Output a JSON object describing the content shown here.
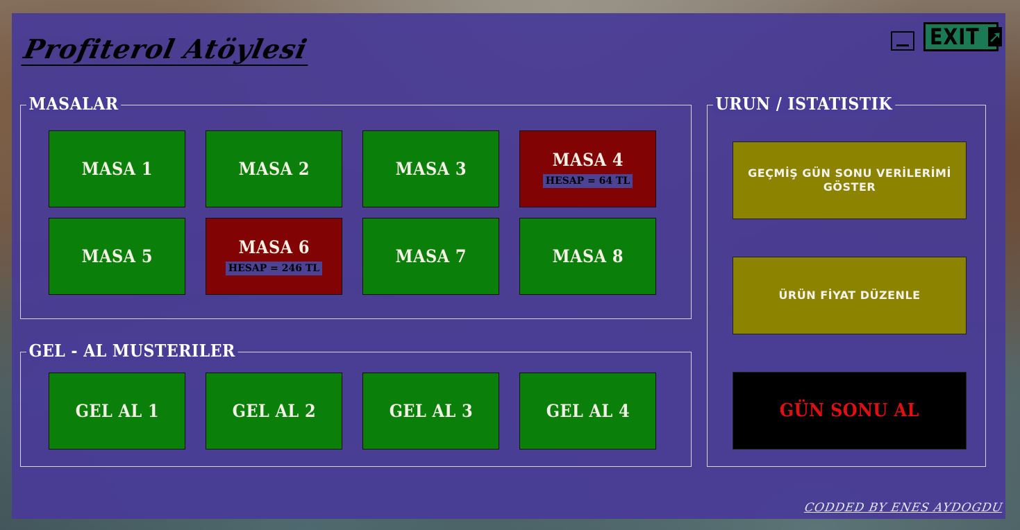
{
  "app": {
    "title": "Profiterol Atöylesi"
  },
  "window_controls": {
    "minimize_icon": "minimize-icon",
    "exit_label": "EXIT",
    "exit_icon": "arrow-up-right-icon",
    "exit_arrow_glyph": "➚"
  },
  "masalar": {
    "title": "MASALAR",
    "tables": [
      {
        "label": "MASA 1",
        "status": "free",
        "bill": ""
      },
      {
        "label": "MASA 2",
        "status": "free",
        "bill": ""
      },
      {
        "label": "MASA 3",
        "status": "free",
        "bill": ""
      },
      {
        "label": "MASA 4",
        "status": "occupied",
        "bill": "HESAP = 64 TL"
      },
      {
        "label": "MASA 5",
        "status": "free",
        "bill": ""
      },
      {
        "label": "MASA 6",
        "status": "occupied",
        "bill": "HESAP = 246 TL"
      },
      {
        "label": "MASA 7",
        "status": "free",
        "bill": ""
      },
      {
        "label": "MASA 8",
        "status": "free",
        "bill": ""
      }
    ]
  },
  "gel_al": {
    "title": "GEL - AL MUSTERILER",
    "items": [
      {
        "label": "GEL AL 1",
        "status": "free"
      },
      {
        "label": "GEL AL 2",
        "status": "free"
      },
      {
        "label": "GEL AL 3",
        "status": "free"
      },
      {
        "label": "GEL AL 4",
        "status": "free"
      }
    ]
  },
  "urun_istatistik": {
    "title": "URUN / ISTATISTIK",
    "past_data_button": "GEÇMİŞ GÜN SONU VERİLERİMİ GÖSTER",
    "edit_prices_button": "ÜRÜN FİYAT DÜZENLE",
    "end_of_day_button": "GÜN SONU AL"
  },
  "footer": {
    "credit": "CODDED BY ENES AYDOGDU"
  },
  "colors": {
    "panel": "#483c96",
    "free_table": "#0a7f0a",
    "occupied_table": "#820303",
    "olive_button": "#8c8300",
    "end_of_day_text": "#e01010",
    "exit_button": "#1a7a55"
  }
}
